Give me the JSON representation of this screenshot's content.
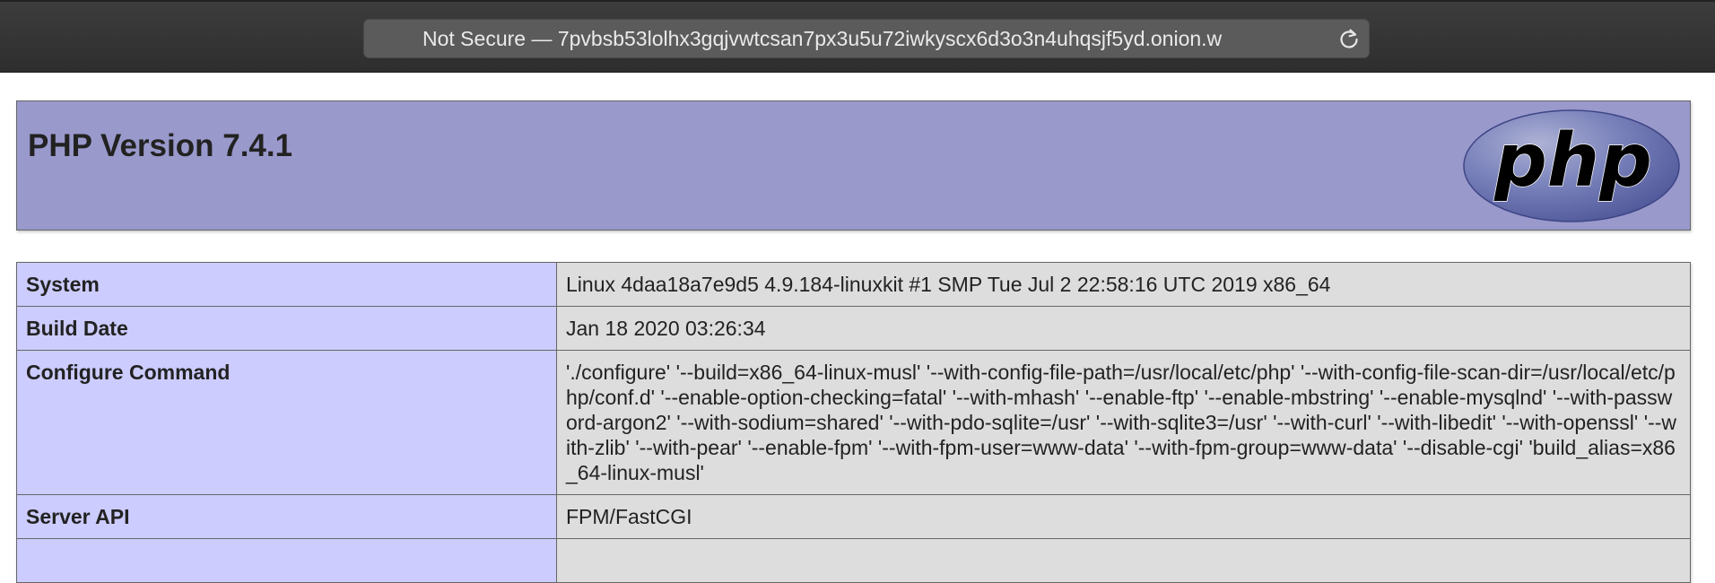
{
  "browser": {
    "address_bar_text": "Not Secure — 7pvbsb53lolhx3gqjvwtcsan7px3u5u72iwkyscx6d3o3n4uhqsjf5yd.onion.w",
    "reload_icon": "reload-icon"
  },
  "page": {
    "title": "PHP Version 7.4.1",
    "logo_text": "php"
  },
  "info_rows": [
    {
      "label": "System",
      "value": "Linux 4daa18a7e9d5 4.9.184-linuxkit #1 SMP Tue Jul 2 22:58:16 UTC 2019 x86_64"
    },
    {
      "label": "Build Date",
      "value": "Jan 18 2020 03:26:34"
    },
    {
      "label": "Configure Command",
      "value": "'./configure' '--build=x86_64-linux-musl' '--with-config-file-path=/usr/local/etc/php' '--with-config-file-scan-dir=/usr/local/etc/php/conf.d' '--enable-option-checking=fatal' '--with-mhash' '--enable-ftp' '--enable-mbstring' '--enable-mysqlnd' '--with-password-argon2' '--with-sodium=shared' '--with-pdo-sqlite=/usr' '--with-sqlite3=/usr' '--with-curl' '--with-libedit' '--with-openssl' '--with-zlib' '--with-pear' '--enable-fpm' '--with-fpm-user=www-data' '--with-fpm-group=www-data' '--disable-cgi' 'build_alias=x86_64-linux-musl'"
    },
    {
      "label": "Server API",
      "value": "FPM/FastCGI"
    }
  ],
  "colors": {
    "header_bg": "#9999cc",
    "label_cell_bg": "#ccccff",
    "value_cell_bg": "#dddddd",
    "logo_fill": "#6c78af"
  }
}
